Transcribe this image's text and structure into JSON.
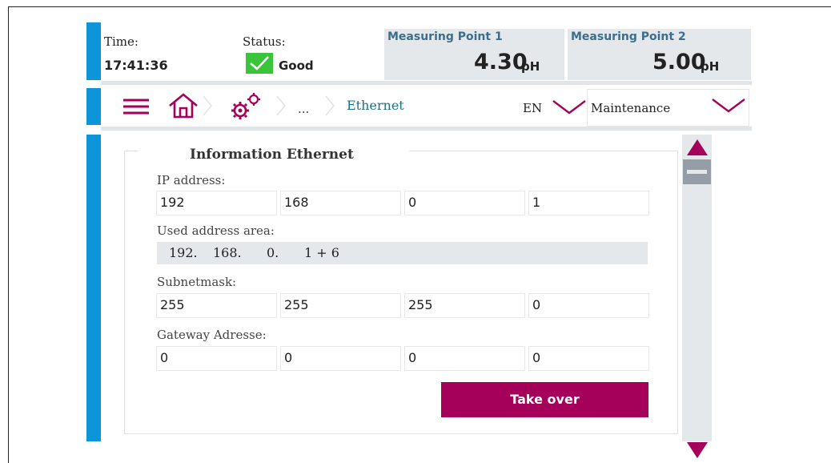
{
  "header": {
    "time_label": "Time:",
    "time_value": "17:41:36",
    "status_label": "Status:",
    "status_value": "Good",
    "measuring_points": [
      {
        "title": "Measuring Point 1",
        "value": "4.30",
        "unit": "pH"
      },
      {
        "title": "Measuring Point 2",
        "value": "5.00",
        "unit": "pH"
      }
    ]
  },
  "nav": {
    "menu_icon": "hamburger-menu-icon",
    "home_icon": "home-icon",
    "settings_icon": "gears-icon",
    "breadcrumb_more": "...",
    "breadcrumb_current": "Ethernet",
    "language": "EN",
    "role": "Maintenance"
  },
  "panel": {
    "title": "Information Ethernet",
    "ip_label": "IP address:",
    "ip_values": [
      "192",
      "168",
      "0",
      "1"
    ],
    "used_area_label": "Used address area:",
    "used_area_values": [
      "192.",
      "168.",
      "0.",
      "1 + 6"
    ],
    "subnet_label": "Subnetmask:",
    "subnet_values": [
      "255",
      "255",
      "255",
      "0"
    ],
    "gateway_label": "Gateway Adresse:",
    "gateway_values": [
      "0",
      "0",
      "0",
      "0"
    ],
    "take_over_label": "Take over"
  },
  "colors": {
    "accent_blue": "#0d95d9",
    "brand_magenta": "#a5005a",
    "status_green": "#3ac43a",
    "panel_gray": "#e5e8ea",
    "link_teal": "#1f6f8a"
  }
}
